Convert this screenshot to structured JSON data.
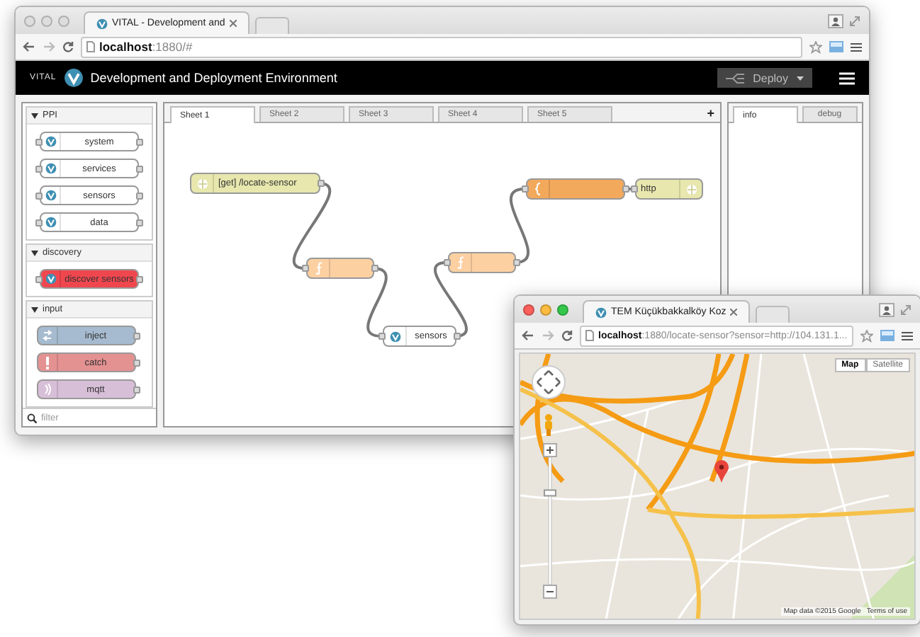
{
  "main_window": {
    "tab_title": "VITAL - Development and",
    "url": "**localhost**:1880/#",
    "app": {
      "brand": "VITAL",
      "title": "Development and Deployment Environment",
      "deploy": "Deploy"
    },
    "palette": {
      "categories": [
        {
          "name": "PPI",
          "expanded": true,
          "nodes": [
            {
              "label": "system",
              "kind": "vital",
              "color": "#ffffff"
            },
            {
              "label": "services",
              "kind": "vital",
              "color": "#ffffff"
            },
            {
              "label": "sensors",
              "kind": "vital",
              "color": "#ffffff"
            },
            {
              "label": "data",
              "kind": "vital",
              "color": "#ffffff"
            }
          ]
        },
        {
          "name": "discovery",
          "expanded": true,
          "nodes": [
            {
              "label": "discover sensors",
              "kind": "vital",
              "color": "#f0474f"
            }
          ]
        },
        {
          "name": "input",
          "expanded": true,
          "nodes": [
            {
              "label": "inject",
              "kind": "inject",
              "color": "#a6bbcf"
            },
            {
              "label": "catch",
              "kind": "catch",
              "color": "#e49191"
            },
            {
              "label": "mqtt",
              "kind": "mqtt",
              "color": "#d8bfd8"
            }
          ]
        }
      ],
      "filter": {
        "placeholder": "filter"
      }
    },
    "sheets": [
      {
        "label": "Sheet 1",
        "selected": true
      },
      {
        "label": "Sheet 2",
        "selected": false
      },
      {
        "label": "Sheet 3",
        "selected": false
      },
      {
        "label": "Sheet 4",
        "selected": false
      },
      {
        "label": "Sheet 5",
        "selected": false
      }
    ],
    "add_sheet": "+",
    "flow_nodes": [
      {
        "kind": "http-in",
        "label": "[get] /locate-sensor",
        "color": "#e7e7ae"
      },
      {
        "kind": "function",
        "color": "#fdd0a2"
      },
      {
        "kind": "vital",
        "label": "sensors",
        "color": "#ffffff"
      },
      {
        "kind": "function",
        "color": "#fdd0a2"
      },
      {
        "kind": "template",
        "color": "#f3a95c"
      },
      {
        "kind": "http-response",
        "label": "http",
        "color": "#e7e7ae"
      }
    ],
    "sidebar_tabs": [
      {
        "label": "info",
        "selected": true
      },
      {
        "label": "debug",
        "selected": false
      }
    ]
  },
  "map_window": {
    "tab_title": "TEM Küçükbakkalköy Koz",
    "url": "**localhost**:1880/locate-sensor?sensor=http://104.131.1...",
    "map_types": [
      {
        "label": "Map",
        "selected": true
      },
      {
        "label": "Satellite",
        "selected": false
      }
    ],
    "zoom": {
      "level": 0.73
    },
    "attribution": "Map data ©2015 Google",
    "terms": "Terms of use"
  }
}
